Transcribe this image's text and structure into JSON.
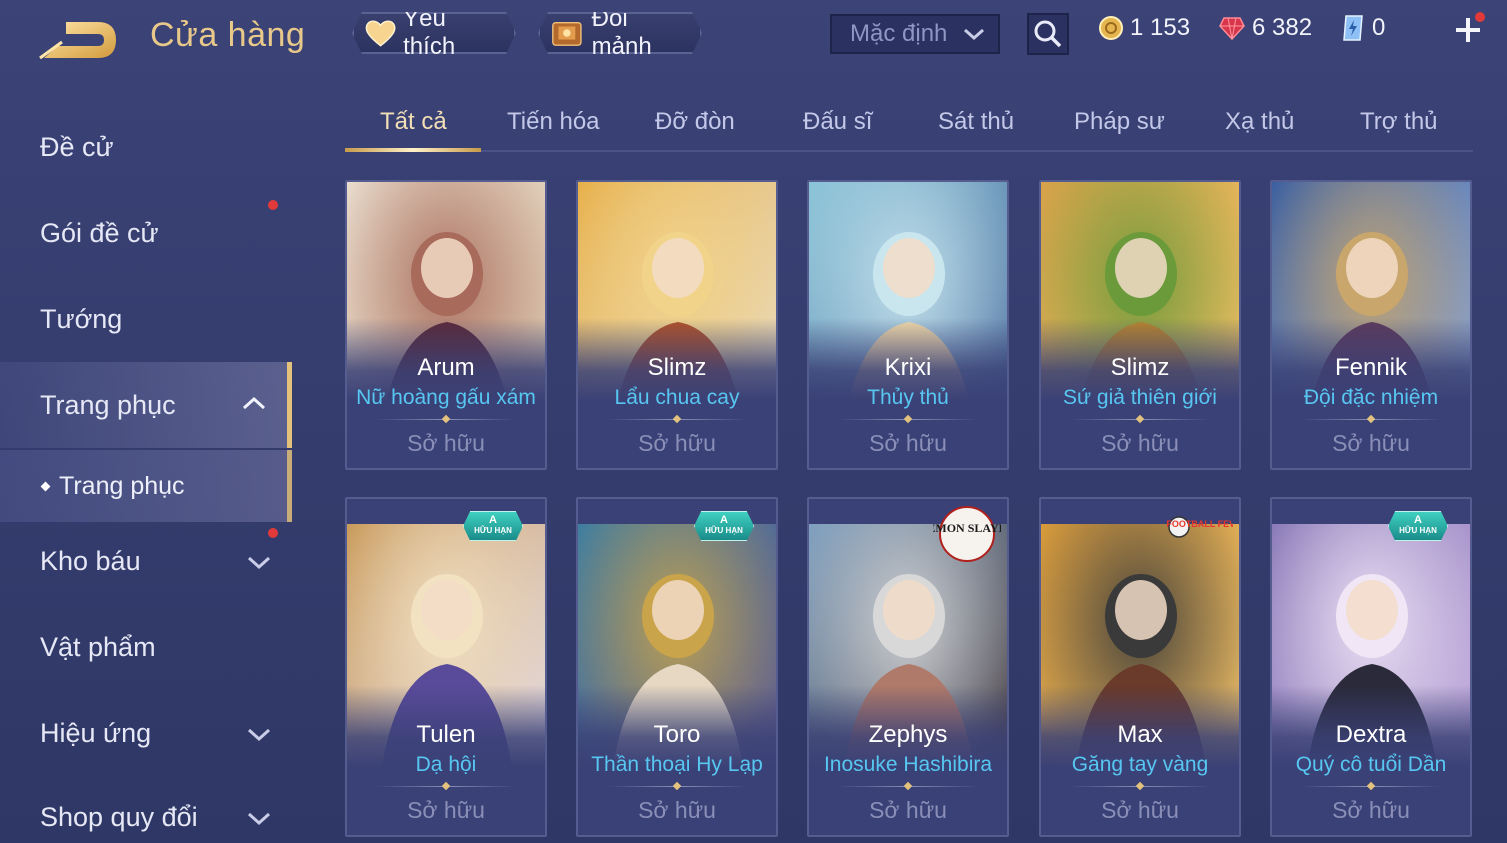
{
  "header": {
    "title": "Cửa hàng",
    "favorite_label": "Yêu thích",
    "exchange_label": "Đổi mảnh",
    "sort_value": "Mặc định",
    "gold": "1 153",
    "gems": "6 382",
    "vouchers": "0"
  },
  "sidebar": {
    "items": [
      {
        "label": "Đề cử"
      },
      {
        "label": "Gói đề cử"
      },
      {
        "label": "Tướng"
      },
      {
        "label": "Trang phục"
      },
      {
        "label": "Kho báu"
      },
      {
        "label": "Vật phẩm"
      },
      {
        "label": "Hiệu ứng"
      },
      {
        "label": "Shop quy đổi"
      }
    ],
    "sub_item": "Trang phục"
  },
  "tabs": [
    "Tất cả",
    "Tiến hóa",
    "Đỡ đòn",
    "Đấu sĩ",
    "Sát thủ",
    "Pháp sư",
    "Xạ thủ",
    "Trợ thủ"
  ],
  "cards": [
    {
      "hero": "Arum",
      "skin": "Nữ hoàng gấu xám",
      "status": "Sở hữu"
    },
    {
      "hero": "Slimz",
      "skin": "Lẩu chua cay",
      "status": "Sở hữu"
    },
    {
      "hero": "Krixi",
      "skin": "Thủy thủ",
      "status": "Sở hữu"
    },
    {
      "hero": "Slimz",
      "skin": "Sứ giả thiên giới",
      "status": "Sở hữu"
    },
    {
      "hero": "Fennik",
      "skin": "Đội đặc nhiệm",
      "status": "Sở hữu"
    },
    {
      "hero": "Tulen",
      "skin": "Dạ hội",
      "status": "Sở hữu"
    },
    {
      "hero": "Toro",
      "skin": "Thần thoại Hy Lạp",
      "status": "Sở hữu"
    },
    {
      "hero": "Zephys",
      "skin": "Inosuke Hashibira",
      "status": "Sở hữu"
    },
    {
      "hero": "Max",
      "skin": "Găng tay vàng",
      "status": "Sở hữu"
    },
    {
      "hero": "Dextra",
      "skin": "Quý cô tuổi Dần",
      "status": "Sở hữu"
    }
  ],
  "badges": {
    "limited_letter": "A",
    "limited_text": "HỮU HẠN",
    "demon_slayer": "DEMON SLAYER",
    "football_fever": "FOOTBALL FEVER"
  },
  "colors": {
    "background": "#363e70",
    "title_gold": "#e8c98a",
    "skin_name_cyan": "#57c6f1",
    "owned_gray": "#8a8fb8",
    "notification_red": "#e23a3a",
    "limited_badge_teal": "#2bb3a6"
  }
}
